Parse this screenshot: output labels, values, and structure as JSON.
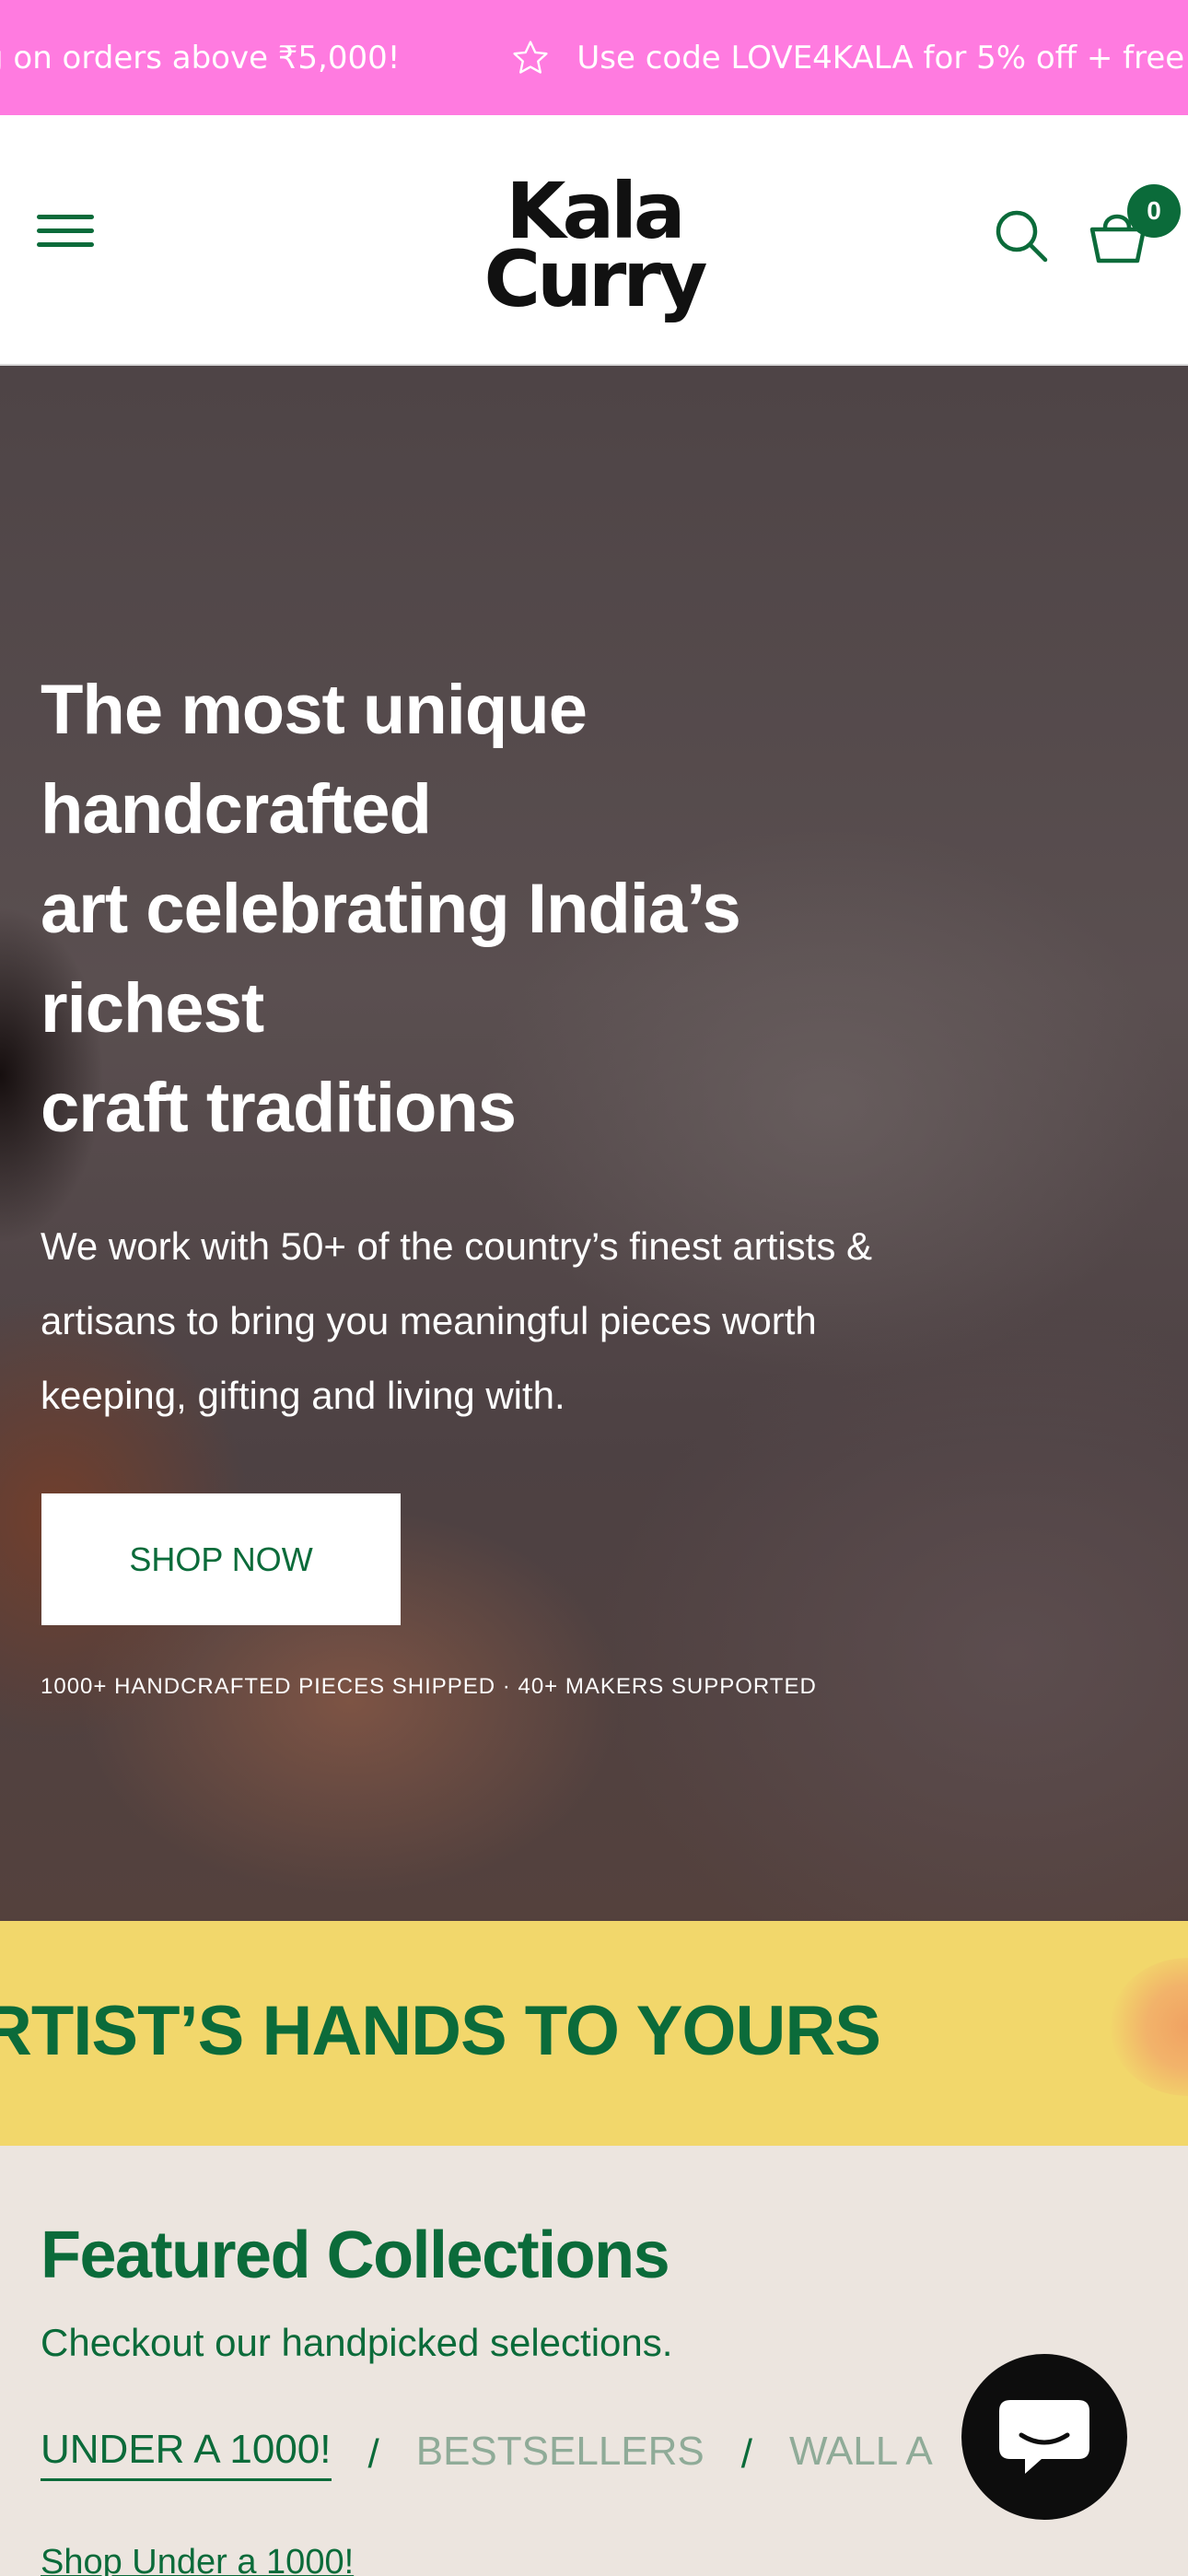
{
  "announcement": {
    "text_1": "g on orders above ₹5,000!",
    "text_2": "Use code LOVE4KALA for 5% off + free",
    "star_icon": "star-outline-icon"
  },
  "header": {
    "logo_line_1": "Kala",
    "logo_line_2": "Curry",
    "menu_icon": "hamburger-menu-icon",
    "search_icon": "search-icon",
    "cart_icon": "basket-icon",
    "cart_count": "0"
  },
  "hero": {
    "title_lines": [
      "The most unique",
      "handcrafted",
      "art celebrating India’s",
      "richest",
      "craft traditions"
    ],
    "subtitle_lines": [
      "We work with 50+ of the country’s finest artists &",
      "artisans to bring you meaningful pieces worth",
      "keeping, gifting and living with."
    ],
    "cta_label": "SHOP NOW",
    "stats": "1000+ HANDCRAFTED PIECES SHIPPED · 40+ MAKERS SUPPORTED"
  },
  "band": {
    "text": "RTIST’S HANDS TO YOURS"
  },
  "featured": {
    "title": "Featured Collections",
    "subtitle": "Checkout our handpicked selections.",
    "tabs": [
      "UNDER A 1000!",
      "BESTSELLERS",
      "WALL A"
    ],
    "separator": "/",
    "link": "Shop Under a 1000!"
  },
  "chat": {
    "icon": "chat-bubble-icon"
  },
  "colors": {
    "brand_green": "#0b6b3a",
    "announcement_pink": "#ff7be0",
    "band_yellow": "#f2d76b",
    "page_beige": "#ece5df"
  }
}
